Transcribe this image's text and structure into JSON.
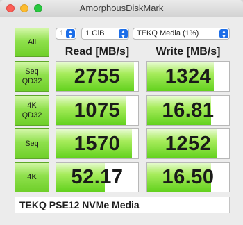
{
  "window": {
    "title": "AmorphousDiskMark"
  },
  "controls": {
    "all_label": "All",
    "count_value": "1",
    "size_value": "1 GiB",
    "drive_value": "TEKQ Media (1%)"
  },
  "headers": {
    "read": "Read [MB/s]",
    "write": "Write [MB/s]"
  },
  "rows": [
    {
      "label_line1": "Seq",
      "label_line2": "QD32",
      "read": "2755",
      "write": "1324",
      "read_fill": 0.95,
      "write_fill": 0.81
    },
    {
      "label_line1": "4K",
      "label_line2": "QD32",
      "read": "1075",
      "write": "16.81",
      "read_fill": 0.86,
      "write_fill": 0.78
    },
    {
      "label_line1": "Seq",
      "label_line2": "",
      "read": "1570",
      "write": "1252",
      "read_fill": 0.92,
      "write_fill": 0.85
    },
    {
      "label_line1": "4K",
      "label_line2": "",
      "read": "52.17",
      "write": "16.50",
      "read_fill": 0.59,
      "write_fill": 0.78
    }
  ],
  "comment": "TEKQ PSE12 NVMe Media",
  "colors": {
    "accent_green": "#6fcf2a",
    "select_blue": "#1d6ee8"
  }
}
